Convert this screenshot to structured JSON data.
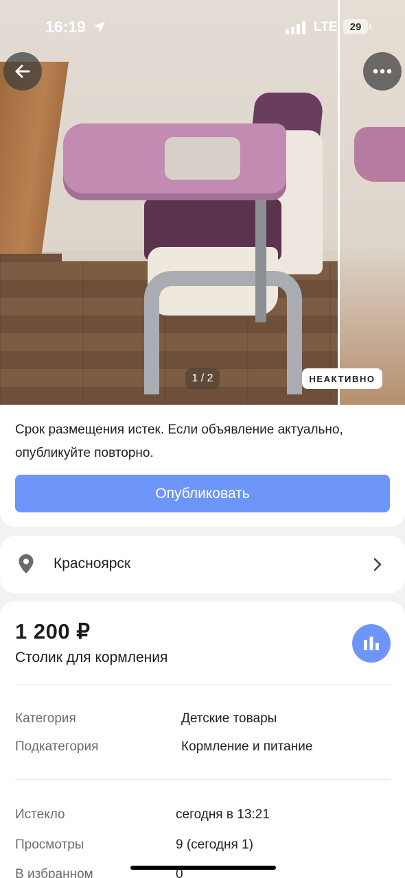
{
  "status_bar": {
    "time": "16:19",
    "network": "LTE",
    "battery": "29"
  },
  "photo": {
    "counter": "1 / 2",
    "status_badge": "НЕАКТИВНО",
    "back_icon": "arrow-left-icon",
    "more_icon": "more-dots-icon"
  },
  "publish": {
    "notice": "Срок размещения истек. Если объявление актуально, опубликуйте повторно.",
    "button_label": "Опубликовать"
  },
  "location": {
    "city": "Красноярск",
    "icon": "location-pin-icon"
  },
  "listing": {
    "price": "1 200 ₽",
    "title": "Столик для кормления",
    "stats_icon": "bar-chart-icon",
    "details": [
      {
        "label": "Категория",
        "value": "Детские товары"
      },
      {
        "label": "Подкатегория",
        "value": "Кормление и питание"
      }
    ],
    "meta": [
      {
        "label": "Истекло",
        "value": "сегодня в 13:21"
      },
      {
        "label": "Просмотры",
        "value": "9 (сегодня 1)"
      },
      {
        "label": "В избранном",
        "value": "0"
      }
    ]
  },
  "colors": {
    "accent": "#6e95f9",
    "background": "#f2f2f2"
  }
}
